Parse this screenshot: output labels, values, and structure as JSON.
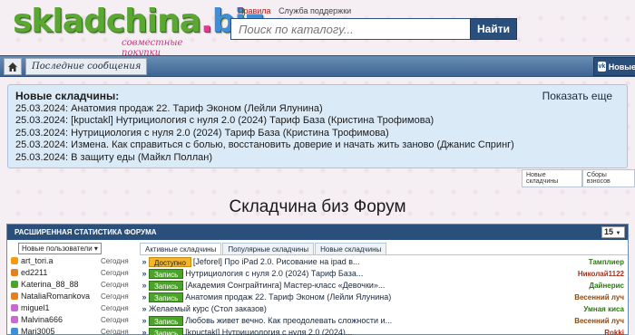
{
  "header": {
    "logo_text_1": "skladchina",
    "logo_dot": ".",
    "logo_text_2": "biz",
    "logo_subtitle": "совместные покупки",
    "link_rules": "Правила",
    "link_support": "Служба поддержки",
    "search_placeholder": "Поиск по каталогу...",
    "search_button": "Найти"
  },
  "nav": {
    "recent_label": "Последние сообщения",
    "news_label": "Новые"
  },
  "new_block": {
    "title": "Новые складчины:",
    "more": "Показать еще",
    "items": [
      "25.03.2024: Анатомия продаж 22. Тариф Эконом (Лейли Ялунина)",
      "25.03.2024: [kpuctakl] Нутрициология с нуля 2.0 (2024) Тариф База (Кристина Трофимова)",
      "25.03.2024: Нутрициология с нуля 2.0 (2024) Тариф База (Кристина Трофимова)",
      "25.03.2024: Измена. Как справиться с болью, восстановить доверие и начать жить заново (Джанис Спринг)",
      "25.03.2024: В защиту еды (Майкл Поллан)"
    ],
    "subtabs": [
      "Новые складчины",
      "Сборы взносов"
    ]
  },
  "forum_title": "Складчина биз Форум",
  "stats": {
    "title": "РАСШИРЕННАЯ СТАТИСТИКА ФОРУМА",
    "limit": "15",
    "user_select": "Новые пользователи",
    "users": [
      {
        "name": "art_tori.a",
        "time": "Сегодня",
        "color": "#f39c12"
      },
      {
        "name": "ed2211",
        "time": "Сегодня",
        "color": "#e67e22"
      },
      {
        "name": "Katerina_88_88",
        "time": "Сегодня",
        "color": "#4ca32a"
      },
      {
        "name": "NataliaRomankova",
        "time": "Сегодня",
        "color": "#e67e22"
      },
      {
        "name": "miguel1",
        "time": "Сегодня",
        "color": "#c86bd0"
      },
      {
        "name": "Malvina666",
        "time": "Сегодня",
        "color": "#c86bd0"
      },
      {
        "name": "Mari3005",
        "time": "Сегодня",
        "color": "#3f8fd8"
      }
    ],
    "tabs": [
      "Активные складчины",
      "Популярные складчины",
      "Новые складчины"
    ],
    "feed": [
      {
        "badge": "Доступно",
        "type": "avail",
        "title": "[Jeforel] Про iPad 2.0. Рисование на ipad в...",
        "user": "Тамплиер",
        "ucolor": "#2f7715"
      },
      {
        "badge": "Запись",
        "type": "rec",
        "title": "Нутрициология с нуля 2.0 (2024) Тариф База...",
        "user": "Николай1122",
        "ucolor": "#a0301c"
      },
      {
        "badge": "Запись",
        "type": "rec",
        "title": "[Академия Сонграйтинга] Мастер-класс «Девочки»...",
        "user": "Дайнерис",
        "ucolor": "#2f7715"
      },
      {
        "badge": "Запись",
        "type": "rec",
        "title": "Анатомия продаж 22. Тариф Эконом (Лейли Ялунина)",
        "user": "Весенний луч",
        "ucolor": "#8a4b12"
      },
      {
        "badge": "",
        "type": "",
        "title": "Желаемый курс (Стол заказов)",
        "user": "Умная киса",
        "ucolor": "#2f7715"
      },
      {
        "badge": "Запись",
        "type": "rec",
        "title": "Любовь живет вечно. Как преодолевать сложности и...",
        "user": "Весенний луч",
        "ucolor": "#8a4b12"
      },
      {
        "badge": "Запись",
        "type": "rec",
        "title": "[kpuctakl] Нутрициология с нуля 2.0 (2024)...",
        "user": "Rokki",
        "ucolor": "#a0301c"
      }
    ]
  }
}
